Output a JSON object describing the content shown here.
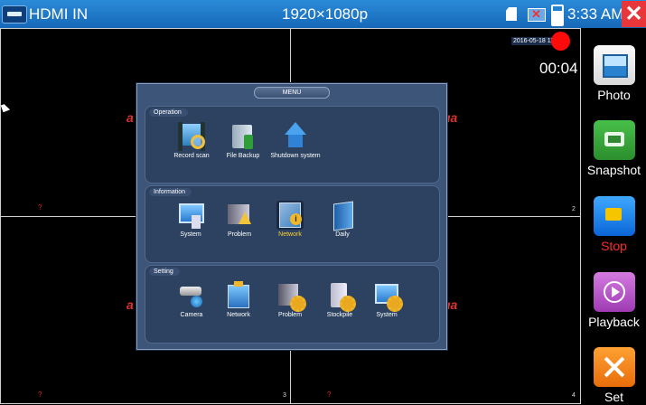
{
  "topbar": {
    "title": "HDMI IN",
    "resolution": "1920×1080p",
    "time": "3:33 AM",
    "icons": [
      "hdmi-icon",
      "sd-card-icon",
      "network-disconnected-icon",
      "battery-icon",
      "close-icon"
    ]
  },
  "video": {
    "date_stamp": "2016-05-18 11",
    "timer": "00:04",
    "channel_numbers": [
      "2",
      "3",
      "4"
    ],
    "logo_fragment": "a",
    "logo_fragment_right": "ua",
    "marker": "?"
  },
  "menu": {
    "title": "MENU",
    "sections": [
      {
        "label": "Operation",
        "items": [
          {
            "label": "Record scan",
            "icon": "film-search-icon"
          },
          {
            "label": "File Backup",
            "icon": "file-backup-icon"
          },
          {
            "label": "Shutdown system",
            "icon": "house-shutdown-icon"
          }
        ]
      },
      {
        "label": "Information",
        "items": [
          {
            "label": "System",
            "icon": "monitor-icon"
          },
          {
            "label": "Problem",
            "icon": "warning-icon"
          },
          {
            "label": "Network",
            "icon": "network-info-icon",
            "active": true
          },
          {
            "label": "Daily",
            "icon": "book-icon"
          }
        ]
      },
      {
        "label": "Setting",
        "items": [
          {
            "label": "Camera",
            "icon": "camera-icon"
          },
          {
            "label": "Network",
            "icon": "network-config-icon"
          },
          {
            "label": "Problem",
            "icon": "problem-gear-icon"
          },
          {
            "label": "Stockpile",
            "icon": "storage-gear-icon"
          },
          {
            "label": "System",
            "icon": "system-gear-icon"
          }
        ]
      }
    ]
  },
  "sidebar": {
    "buttons": [
      {
        "label": "Photo",
        "icon": "photo-icon"
      },
      {
        "label": "Snapshot",
        "icon": "camera-snapshot-icon"
      },
      {
        "label": "Stop",
        "icon": "record-stop-icon",
        "color": "#ff2a2a"
      },
      {
        "label": "Playback",
        "icon": "playback-icon"
      },
      {
        "label": "Set",
        "icon": "tools-icon"
      }
    ]
  },
  "colors": {
    "topbar": "#1e7bd0",
    "menu_bg": "#3d5578",
    "active_label": "#ffcf33",
    "stop_label": "#ff2a2a",
    "record": "#ff0a0a",
    "close": "#e8373a"
  }
}
